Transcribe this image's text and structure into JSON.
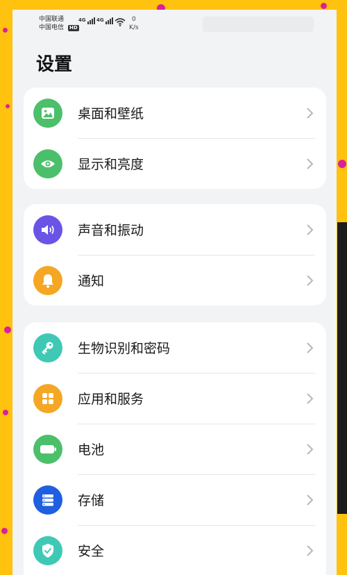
{
  "status_bar": {
    "carrier1": "中国联通",
    "carrier2": "中国电信",
    "hd_badge": "HD",
    "network1": "4G",
    "network2": "4G",
    "speed_value": "0",
    "speed_unit": "K/s"
  },
  "page": {
    "title": "设置"
  },
  "groups": [
    {
      "items": [
        {
          "label": "桌面和壁纸",
          "icon": "wallpaper-icon",
          "color": "#4cbf6b"
        },
        {
          "label": "显示和亮度",
          "icon": "eye-icon",
          "color": "#4cbf6b"
        }
      ]
    },
    {
      "items": [
        {
          "label": "声音和振动",
          "icon": "speaker-icon",
          "color": "#6a54e6"
        },
        {
          "label": "通知",
          "icon": "bell-icon",
          "color": "#f5a623"
        }
      ]
    },
    {
      "items": [
        {
          "label": "生物识别和密码",
          "icon": "key-icon",
          "color": "#3fc9b4"
        },
        {
          "label": "应用和服务",
          "icon": "apps-grid-icon",
          "color": "#f5a623"
        },
        {
          "label": "电池",
          "icon": "battery-icon",
          "color": "#4cbf6b"
        },
        {
          "label": "存储",
          "icon": "storage-icon",
          "color": "#1f5fe0"
        },
        {
          "label": "安全",
          "icon": "shield-check-icon",
          "color": "#3fc9b4"
        }
      ]
    }
  ]
}
